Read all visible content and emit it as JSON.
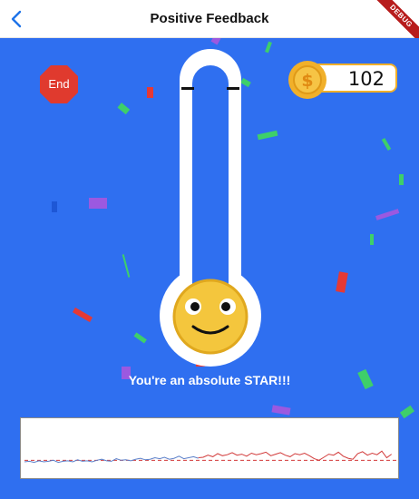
{
  "appbar": {
    "title": "Positive Feedback",
    "debug_label": "DEBUG",
    "back_icon": "chevron-left-icon"
  },
  "controls": {
    "end_label": "End"
  },
  "coins": {
    "value": "102",
    "icon": "dollar-coin-icon"
  },
  "feedback": {
    "message": "You're an absolute STAR!!!",
    "mascot": "smiley-face"
  },
  "colors": {
    "background": "#2f6ff0",
    "end_button": "#e03a2e",
    "coin": "#f1b02a",
    "smiley": "#f4c63d",
    "line_blue": "#5b7fc9",
    "line_red": "#d23a3a"
  },
  "chart_data": {
    "type": "line",
    "title": "",
    "xlabel": "",
    "ylabel": "",
    "grid": false,
    "legend": "none",
    "ylim": [
      0,
      1
    ],
    "threshold": 0.28,
    "series": [
      {
        "values": [
          0.25,
          0.26,
          0.24,
          0.27,
          0.25,
          0.26,
          0.28,
          0.24,
          0.26,
          0.27,
          0.25,
          0.29,
          0.26,
          0.27,
          0.25,
          0.28,
          0.3,
          0.27,
          0.26,
          0.31,
          0.28,
          0.29,
          0.27,
          0.3,
          0.32,
          0.29,
          0.3,
          0.33,
          0.31,
          0.34,
          0.3,
          0.32,
          0.36,
          0.31,
          0.33,
          0.35,
          0.32
        ]
      },
      {
        "values": [
          0.33,
          0.34,
          0.38,
          0.35,
          0.41,
          0.37,
          0.39,
          0.43,
          0.38,
          0.4,
          0.36,
          0.42,
          0.39,
          0.41,
          0.44,
          0.37,
          0.4,
          0.43,
          0.38,
          0.35,
          0.41,
          0.39,
          0.42,
          0.37,
          0.31,
          0.28,
          0.34,
          0.4,
          0.38,
          0.44,
          0.36,
          0.32,
          0.3,
          0.41,
          0.45,
          0.38,
          0.42,
          0.39,
          0.46,
          0.33,
          0.4
        ]
      }
    ]
  }
}
